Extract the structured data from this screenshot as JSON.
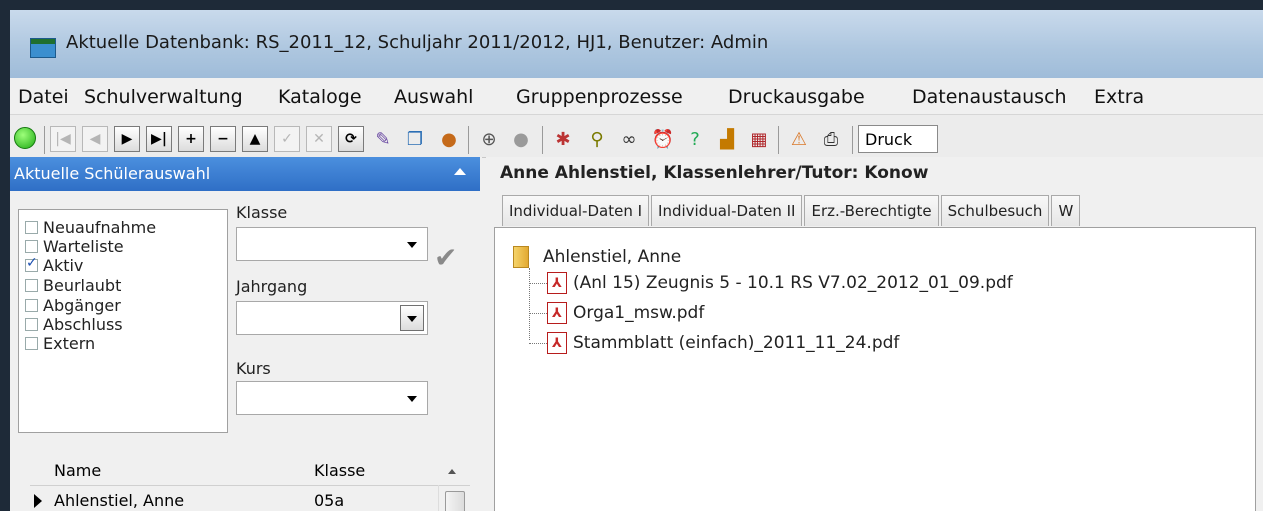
{
  "window": {
    "title": "Aktuelle Datenbank: RS_2011_12, Schuljahr 2011/2012, HJ1, Benutzer: Admin"
  },
  "menu": [
    "Datei",
    "Schulverwaltung",
    "Kataloge",
    "Auswahl",
    "Gruppenprozesse",
    "Druckausgabe",
    "Datenaustausch",
    "Extra"
  ],
  "toolbar": {
    "print_combo": "Druck"
  },
  "filter_panel": {
    "header": "Aktuelle Schülerauswahl",
    "status_options": [
      {
        "label": "Neuaufnahme",
        "checked": false
      },
      {
        "label": "Warteliste",
        "checked": false
      },
      {
        "label": "Aktiv",
        "checked": true
      },
      {
        "label": "Beurlaubt",
        "checked": false
      },
      {
        "label": "Abgänger",
        "checked": false
      },
      {
        "label": "Abschluss",
        "checked": false
      },
      {
        "label": "Extern",
        "checked": false
      }
    ],
    "klasse_label": "Klasse",
    "jahrgang_label": "Jahrgang",
    "kurs_label": "Kurs"
  },
  "student_list": {
    "columns": [
      "Name",
      "Klasse"
    ],
    "rows": [
      {
        "name": "Ahlenstiel, Anne",
        "klasse": "05a"
      }
    ]
  },
  "detail": {
    "heading": "Anne Ahlenstiel, Klassenlehrer/Tutor: Konow",
    "tabs": [
      "Individual-Daten I",
      "Individual-Daten II",
      "Erz.-Berechtigte",
      "Schulbesuch",
      "W"
    ],
    "tree": {
      "root": "Ahlenstiel, Anne",
      "files": [
        "(Anl 15) Zeugnis 5 - 10.1 RS V7.02_2012_01_09.pdf",
        "Orga1_msw.pdf",
        "Stammblatt (einfach)_2011_11_24.pdf"
      ]
    }
  }
}
